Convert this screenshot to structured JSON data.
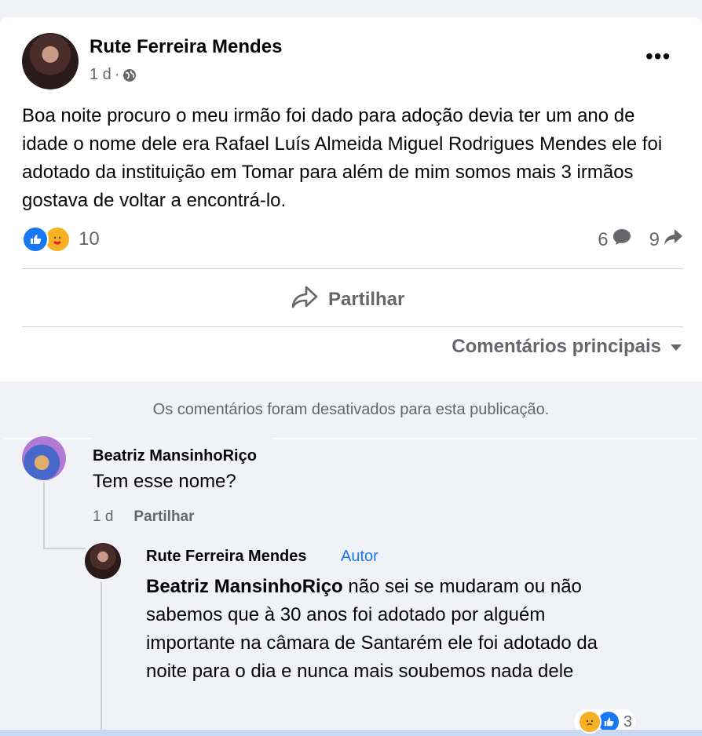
{
  "post": {
    "author": "Rute Ferreira Mendes",
    "time": "1 d",
    "separator": "·",
    "text": "Boa noite procuro o meu irmão foi dado para adoção devia ter um ano de idade o nome dele era Rafael Luís Almeida Miguel Rodrigues Mendes ele foi adotado da instituição em Tomar para além de mim somos mais 3 irmãos gostava de voltar a encontrá-lo.",
    "reaction_count": "10",
    "comment_count": "6",
    "share_count": "9",
    "more_icon": "more-horizontal-icon"
  },
  "actions": {
    "share_label": "Partilhar",
    "sort_label": "Comentários principais"
  },
  "comments_notice": "Os comentários foram desativados para esta publicação.",
  "comments": [
    {
      "author": "Beatriz MansinhoRiço",
      "text": "Tem esse nome?",
      "time": "1 d",
      "share_label": "Partilhar"
    }
  ],
  "reply": {
    "author": "Rute Ferreira Mendes",
    "badge": "Autor",
    "mention": "Beatriz MansinhoRiço",
    "text": " não sei se mudaram ou não sabemos que à 30 anos foi adotado por alguém importante na câmara de Santarém ele foi adotado da noite para o dia e nunca mais soubemos nada dele",
    "reaction_count": "3"
  },
  "colors": {
    "accent": "#1877f2",
    "secondary_text": "#65676b",
    "bubble": "#f0f2f5"
  }
}
